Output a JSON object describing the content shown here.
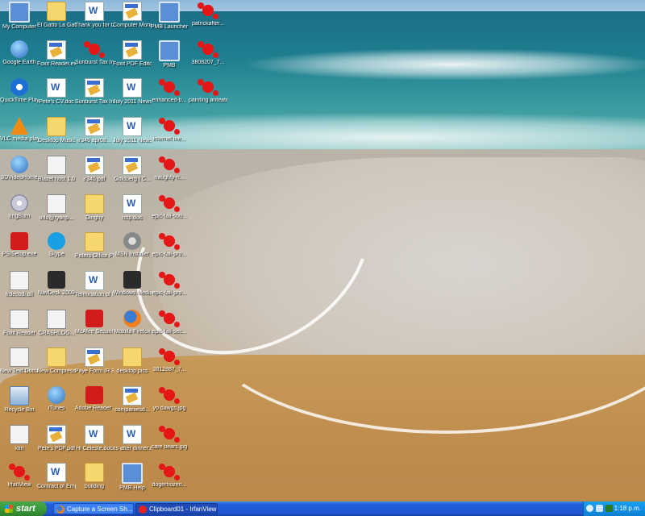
{
  "desktop": {
    "icons": [
      {
        "label": "My Computer",
        "icon": "computer-icon",
        "kind": "pc"
      },
      {
        "label": "Google Earth",
        "icon": "globe-icon",
        "kind": "globe"
      },
      {
        "label": "QuickTime Player",
        "icon": "quicktime-icon",
        "kind": "qt"
      },
      {
        "label": "VLC media player",
        "icon": "vlc-cone-icon",
        "kind": "vlc"
      },
      {
        "label": "3DVideoHome",
        "icon": "globe-icon",
        "kind": "globe"
      },
      {
        "label": "ImgBurn",
        "icon": "disc-icon",
        "kind": "cd"
      },
      {
        "label": "PSISetup.exe",
        "icon": "app-icon",
        "kind": "red"
      },
      {
        "label": "frdecodi.dll",
        "icon": "dll-icon",
        "kind": "shortcut"
      },
      {
        "label": "Foxit Reader",
        "icon": "foxit-icon",
        "kind": "shortcut"
      },
      {
        "label": "New Text Document.txt",
        "icon": "text-file-icon",
        "kind": "shortcut"
      },
      {
        "label": "Recycle Bin",
        "icon": "recycle-bin-icon",
        "kind": "bin"
      },
      {
        "label": "ktm",
        "icon": "file-icon",
        "kind": "shortcut"
      },
      {
        "label": "IrfanView",
        "icon": "irfanview-icon",
        "kind": "splat"
      },
      {
        "label": "El Gatto La Gatita y...",
        "icon": "folder-icon",
        "kind": "folder"
      },
      {
        "label": "Foxit Reader.exe",
        "icon": "pdf-icon",
        "kind": "pdf"
      },
      {
        "label": "Pete's CV.doc",
        "icon": "word-doc-icon",
        "kind": "doc"
      },
      {
        "label": "Desktop Music",
        "icon": "folder-icon",
        "kind": "folder"
      },
      {
        "label": "Blazet host 1.0",
        "icon": "app-icon",
        "kind": "shortcut"
      },
      {
        "label": "info@ryanp...",
        "icon": "file-icon",
        "kind": "shortcut"
      },
      {
        "label": "Skype",
        "icon": "skype-icon",
        "kind": "skype"
      },
      {
        "label": "NavDesk 2009",
        "icon": "app-icon",
        "kind": "dark"
      },
      {
        "label": "CRASHLOG...",
        "icon": "file-icon",
        "kind": "shortcut"
      },
      {
        "label": "New Compress...",
        "icon": "zip-folder-icon",
        "kind": "folder"
      },
      {
        "label": "iTunes",
        "icon": "itunes-icon",
        "kind": "globe"
      },
      {
        "label": "Pete's PDF.pdf",
        "icon": "pdf-icon",
        "kind": "pdf"
      },
      {
        "label": "Contract of Employmen...",
        "icon": "word-doc-icon",
        "kind": "doc"
      },
      {
        "label": "Thank you for taking this...",
        "icon": "word-doc-icon",
        "kind": "doc"
      },
      {
        "label": "Sunburst Tax Invoice 30h...",
        "icon": "irfanview-icon",
        "kind": "splat"
      },
      {
        "label": "Sunburst Tax Invoice.pdf",
        "icon": "pdf-icon",
        "kind": "pdf"
      },
      {
        "label": "ir345 apr08...",
        "icon": "pdf-icon",
        "kind": "pdf"
      },
      {
        "label": "ir345.pdf",
        "icon": "pdf-icon",
        "kind": "pdf"
      },
      {
        "label": "Dinghy",
        "icon": "folder-icon",
        "kind": "folder"
      },
      {
        "label": "Peters Office Photos",
        "icon": "folder-icon",
        "kind": "folder"
      },
      {
        "label": "Termination of Lease Uni...",
        "icon": "word-doc-icon",
        "kind": "doc"
      },
      {
        "label": "McAfee Security...",
        "icon": "mcafee-icon",
        "kind": "red"
      },
      {
        "label": "Paye Form IR 345, RPA ...",
        "icon": "pdf-icon",
        "kind": "pdf"
      },
      {
        "label": "Adobe Reader X",
        "icon": "adobe-reader-icon",
        "kind": "red"
      },
      {
        "label": "Hi Celeste.doc",
        "icon": "word-doc-icon",
        "kind": "doc"
      },
      {
        "label": "building",
        "icon": "folder-icon",
        "kind": "folder"
      },
      {
        "label": "Computer Monitors an...",
        "icon": "pdf-icon",
        "kind": "pdf"
      },
      {
        "label": "Foxit PDF Editor",
        "icon": "foxit-editor-icon",
        "kind": "pdf"
      },
      {
        "label": "July 2011 Newslet...",
        "icon": "word-doc-icon",
        "kind": "doc"
      },
      {
        "label": "July 2011 Newslet...",
        "icon": "word-doc-icon",
        "kind": "doc"
      },
      {
        "label": "Goldberg I C...",
        "icon": "pdf-icon",
        "kind": "pdf"
      },
      {
        "label": "http.doc",
        "icon": "word-doc-icon",
        "kind": "doc"
      },
      {
        "label": "MSN Installer",
        "icon": "msn-icon",
        "kind": "gear"
      },
      {
        "label": "Windows Media Player",
        "icon": "media-player-icon",
        "kind": "dark"
      },
      {
        "label": "Mozilla Firefox",
        "icon": "firefox-icon",
        "kind": "ff"
      },
      {
        "label": "desktop pics",
        "icon": "folder-icon",
        "kind": "folder"
      },
      {
        "label": "companiesd...",
        "icon": "pdf-icon",
        "kind": "pdf"
      },
      {
        "label": "its after dinner.doc",
        "icon": "word-doc-icon",
        "kind": "doc"
      },
      {
        "label": "PMB Help",
        "icon": "help-icon",
        "kind": "pc"
      },
      {
        "label": "PMB Launcher",
        "icon": "pmb-icon",
        "kind": "pc"
      },
      {
        "label": "PMB",
        "icon": "pmb-icon",
        "kind": "pc"
      },
      {
        "label": "enhanced-b...",
        "icon": "irfanview-icon",
        "kind": "splat"
      },
      {
        "label": "internet ine...",
        "icon": "irfanview-icon",
        "kind": "splat"
      },
      {
        "label": "naughty-n...",
        "icon": "irfanview-icon",
        "kind": "splat"
      },
      {
        "label": "epic-fail-sou...",
        "icon": "irfanview-icon",
        "kind": "splat"
      },
      {
        "label": "epic-fail-pro...",
        "icon": "irfanview-icon",
        "kind": "splat"
      },
      {
        "label": "epic-fail-pro...",
        "icon": "irfanview-icon",
        "kind": "splat"
      },
      {
        "label": "epic-fail-sec...",
        "icon": "irfanview-icon",
        "kind": "splat"
      },
      {
        "label": "3812887_7...",
        "icon": "irfanview-icon",
        "kind": "splat"
      },
      {
        "label": "yo dawgs.jpg",
        "icon": "irfanview-icon",
        "kind": "splat"
      },
      {
        "label": "care bears.jpg",
        "icon": "irfanview-icon",
        "kind": "splat"
      },
      {
        "label": "dogerhozen...",
        "icon": "irfanview-icon",
        "kind": "splat"
      },
      {
        "label": "patrickafter...",
        "icon": "irfanview-icon",
        "kind": "splat"
      },
      {
        "label": "3808207_7...",
        "icon": "irfanview-icon",
        "kind": "splat"
      },
      {
        "label": "painting anteater.jpg",
        "icon": "irfanview-icon",
        "kind": "splat"
      }
    ]
  },
  "taskbar": {
    "start_label": "start",
    "tasks": [
      {
        "label": "Capture a Screen Sh...",
        "icon": "firefox-icon"
      },
      {
        "label": "Clipboard01 - IrfanView",
        "icon": "irfanview-icon"
      }
    ],
    "clock": "1:18 p.m."
  }
}
